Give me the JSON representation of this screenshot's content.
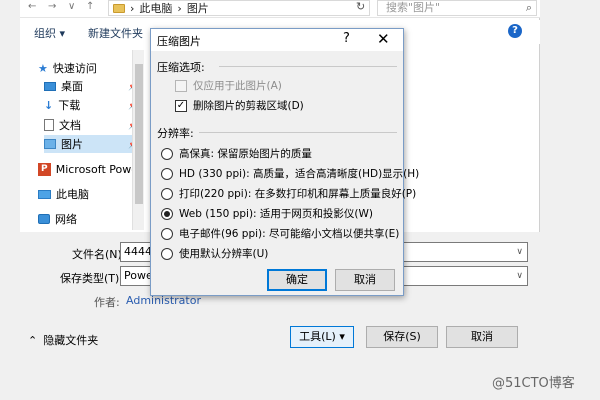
{
  "save_dialog": {
    "address": {
      "back": "←",
      "forward": "→",
      "dropdown": "∨",
      "up": "↑",
      "path_sep": "›",
      "path": [
        "此电脑",
        "图片"
      ]
    },
    "search_placeholder": "搜索\"图片\"",
    "toolbar": {
      "organize": "组织 ▾",
      "new_folder": "新建文件夹",
      "help": "?"
    },
    "nav": [
      {
        "label": "快速访问",
        "icon": "star-icon"
      },
      {
        "label": "桌面",
        "icon": "desktop-icon",
        "pinned": true
      },
      {
        "label": "下载",
        "icon": "download-icon",
        "pinned": true
      },
      {
        "label": "文档",
        "icon": "document-icon",
        "pinned": true
      },
      {
        "label": "图片",
        "icon": "picture-folder-icon",
        "pinned": true,
        "selected": true
      },
      {
        "label": "Microsoft Powe",
        "icon": "powerpoint-icon"
      },
      {
        "label": "此电脑",
        "icon": "computer-icon"
      },
      {
        "label": "网络",
        "icon": "network-icon"
      }
    ],
    "pin_glyph": "📌",
    "filename_label": "文件名(N):",
    "filename_value": "4444",
    "filetype_label": "保存类型(T):",
    "filetype_value": "Powe",
    "author_label": "作者:",
    "author_value": "Administrator",
    "hide_folders": "隐藏文件夹",
    "tools_button": "工具(L)",
    "save_button": "保存(S)",
    "cancel_button": "取消"
  },
  "compress_dialog": {
    "title": "压缩图片",
    "help": "?",
    "close": "✕",
    "compression_group": "压缩选项:",
    "only_this_picture": {
      "label": "仅应用于此图片(A)",
      "checked": false,
      "disabled": true
    },
    "delete_cropped": {
      "label": "删除图片的剪裁区域(D)",
      "checked": true
    },
    "resolution_group": "分辨率:",
    "resolutions": [
      {
        "label": "高保真: 保留原始图片的质量",
        "checked": false
      },
      {
        "label": "HD (330 ppi): 高质量，适合高清晰度(HD)显示(H)",
        "checked": false
      },
      {
        "label": "打印(220 ppi): 在多数打印机和屏幕上质量良好(P)",
        "checked": false
      },
      {
        "label": "Web (150 ppi): 适用于网页和投影仪(W)",
        "checked": true
      },
      {
        "label": "电子邮件(96 ppi): 尽可能缩小文档以便共享(E)",
        "checked": false
      },
      {
        "label": "使用默认分辨率(U)",
        "checked": false
      }
    ],
    "ok_button": "确定",
    "cancel_button": "取消"
  },
  "watermark": "@51CTO博客",
  "colors": {
    "accent": "#0078d7",
    "selection": "#cce4f7",
    "link": "#2a5db0"
  }
}
